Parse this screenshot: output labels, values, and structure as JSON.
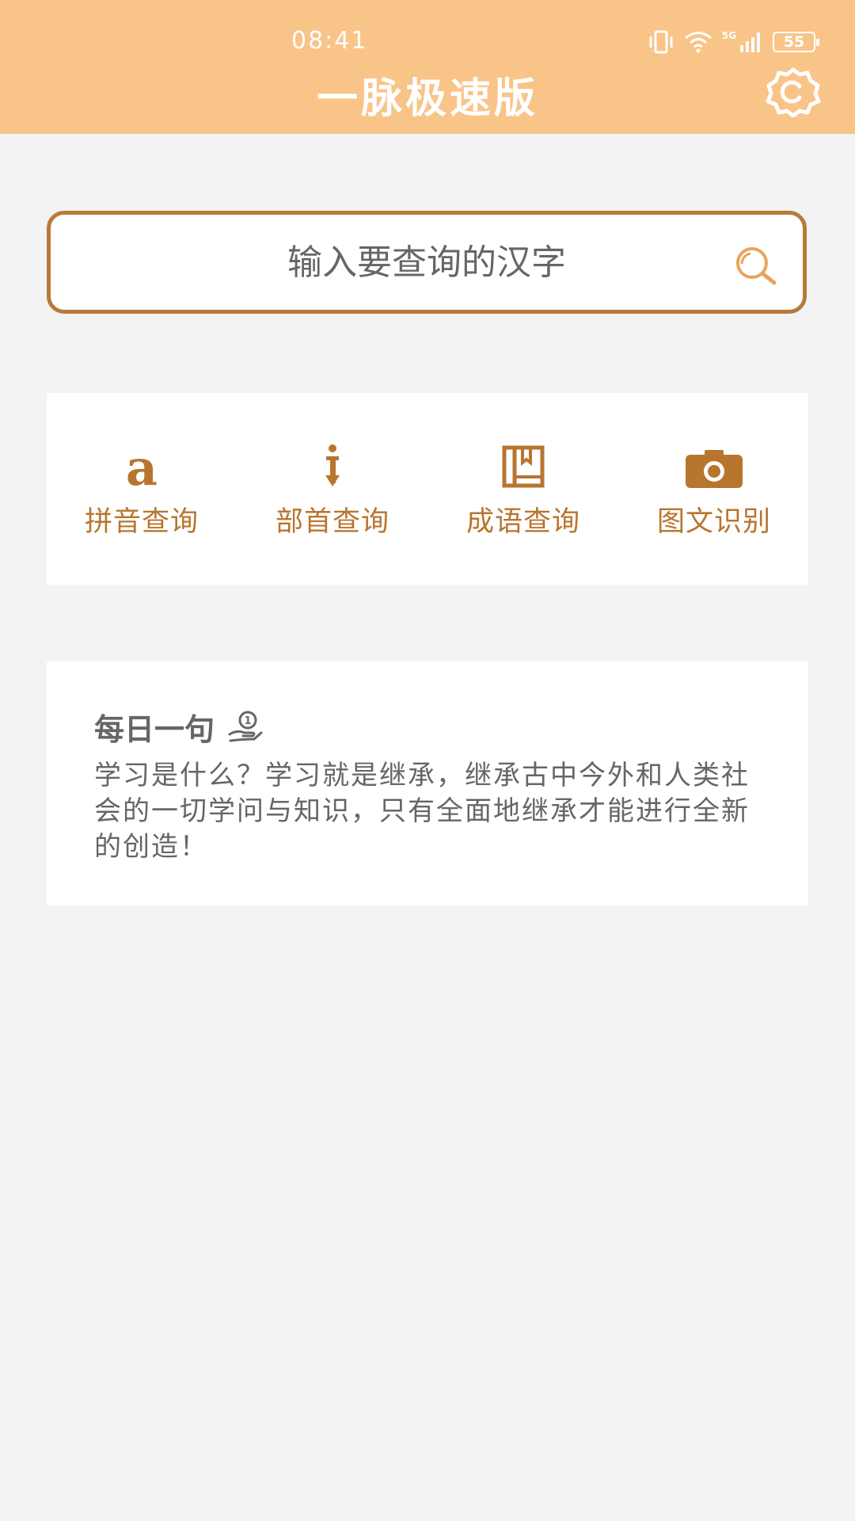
{
  "status_bar": {
    "time": "08:41",
    "network": "5G",
    "battery": "55"
  },
  "header": {
    "title": "一脉极速版",
    "settings_icon": "gear-c-icon"
  },
  "search": {
    "placeholder": "输入要查询的汉字",
    "icon": "search-icon"
  },
  "quick_actions": [
    {
      "label": "拼音查询",
      "icon": "letter-a-icon"
    },
    {
      "label": "部首查询",
      "icon": "radical-icon"
    },
    {
      "label": "成语查询",
      "icon": "book-icon"
    },
    {
      "label": "图文识别",
      "icon": "camera-icon"
    }
  ],
  "daily": {
    "title": "每日一句",
    "icon": "hand-coin-icon",
    "text": "学习是什么？学习就是继承，继承古中今外和人类社会的一切学问与知识，只有全面地继承才能进行全新的创造！"
  },
  "colors": {
    "header_bg": "#f8c488",
    "accent": "#b8752e",
    "background": "#f3f3f3"
  }
}
